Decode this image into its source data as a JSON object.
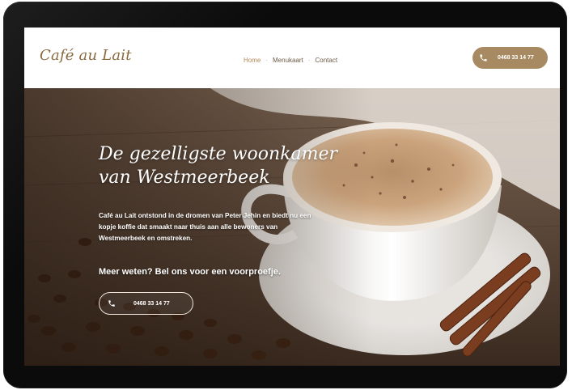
{
  "site": {
    "logo": "Café au Lait"
  },
  "nav": {
    "items": [
      {
        "label": "Home",
        "active": true
      },
      {
        "label": "Menukaart",
        "active": false
      },
      {
        "label": "Contact",
        "active": false
      }
    ],
    "separator": "·"
  },
  "header": {
    "phone_button_label": "0468 33 14 77"
  },
  "hero": {
    "heading": "De gezelligste woonkamer van Westmeerbeek",
    "intro": "Café au Lait ontstond in de dromen van Peter Jehin en biedt nu een kopje koffie dat smaakt naar thuis aan alle bewoners van Westmeerbeek en omstreken.",
    "cta": "Meer weten? Bel ons voor een voorproefje.",
    "phone_button_label": "0468 33 14 77"
  },
  "icons": {
    "phone": "phone-icon"
  },
  "colors": {
    "accent": "#a88a62",
    "logo": "#8a6a3d",
    "nav_active": "#b08a57",
    "device_frame": "#0b0b0b"
  }
}
